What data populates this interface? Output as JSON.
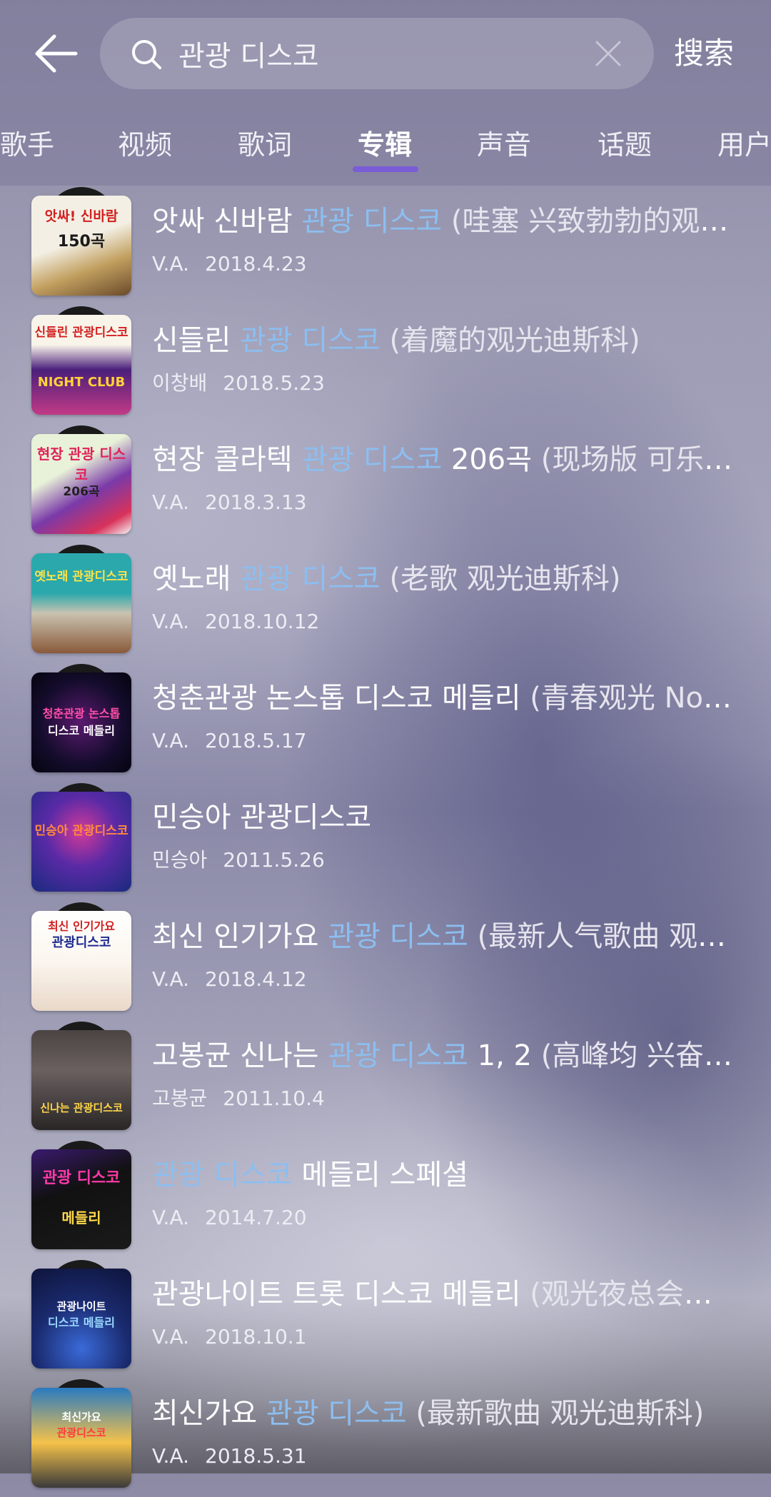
{
  "header": {
    "search_query": "관광 디스코",
    "search_button_label": "搜索"
  },
  "tabs": [
    {
      "label": "歌手",
      "active": false
    },
    {
      "label": "视频",
      "active": false
    },
    {
      "label": "歌词",
      "active": false
    },
    {
      "label": "专辑",
      "active": true
    },
    {
      "label": "声音",
      "active": false
    },
    {
      "label": "话题",
      "active": false
    },
    {
      "label": "用户",
      "active": false
    }
  ],
  "albums": [
    {
      "title_pre": "앗싸 신바람 ",
      "title_hl": "관광 디스코",
      "title_post": "",
      "title_tr": " (哇塞 兴致勃勃的观光迪斯科)",
      "artist": "V.A.",
      "date": "2018.4.23"
    },
    {
      "title_pre": "신들린 ",
      "title_hl": "관광 디스코",
      "title_post": "",
      "title_tr": " (着魔的观光迪斯科)",
      "artist": "이창배",
      "date": "2018.5.23"
    },
    {
      "title_pre": "현장 콜라텍 ",
      "title_hl": "관광 디스코",
      "title_post": " 206곡",
      "title_tr": " (现场版 可乐迪斯科)",
      "artist": "V.A.",
      "date": "2018.3.13"
    },
    {
      "title_pre": "옛노래 ",
      "title_hl": "관광 디스코",
      "title_post": "",
      "title_tr": " (老歌 观光迪斯科)",
      "artist": "V.A.",
      "date": "2018.10.12"
    },
    {
      "title_pre": "청춘관광 논스톱 디스코 메들리",
      "title_hl": "",
      "title_post": "",
      "title_tr": " (青春观光 Nonstop)",
      "artist": "V.A.",
      "date": "2018.5.17"
    },
    {
      "title_pre": "민승아 관광디스코",
      "title_hl": "",
      "title_post": "",
      "title_tr": "",
      "artist": "민승아",
      "date": "2011.5.26"
    },
    {
      "title_pre": "최신 인기가요 ",
      "title_hl": "관광 디스코",
      "title_post": "",
      "title_tr": " (最新人气歌曲 观光迪斯科)",
      "artist": "V.A.",
      "date": "2018.4.12"
    },
    {
      "title_pre": "고봉균 신나는 ",
      "title_hl": "관광 디스코",
      "title_post": " 1, 2",
      "title_tr": " (高峰均 兴奋的观光迪斯科)",
      "artist": "고봉균",
      "date": "2011.10.4"
    },
    {
      "title_pre": "",
      "title_hl": "관광 디스코",
      "title_post": " 메들리 스페셜",
      "title_tr": "",
      "artist": "V.A.",
      "date": "2014.7.20"
    },
    {
      "title_pre": "관광나이트 트롯 디스코 메들리",
      "title_hl": "",
      "title_post": "",
      "title_tr": " (观光夜总会迪斯科)",
      "artist": "V.A.",
      "date": "2018.10.1"
    },
    {
      "title_pre": "최신가요 ",
      "title_hl": "관광 디스코",
      "title_post": "",
      "title_tr": " (最新歌曲 观光迪斯科)",
      "artist": "V.A.",
      "date": "2018.5.31"
    }
  ],
  "covers": [
    {
      "text": "앗싸! 신바람",
      "sub": "150곡",
      "bg": "#f2efe6",
      "fg": "#d21f1f"
    },
    {
      "text": "신들린 관광디스코",
      "sub": "NIGHT CLUB",
      "bg": "#3a1a5e",
      "fg": "#ffd23a"
    },
    {
      "text": "현장 관광 디스코",
      "sub": "206곡",
      "bg": "#e7f0d8",
      "fg": "#e0225a"
    },
    {
      "text": "옛노래 관광디스코",
      "sub": "",
      "bg": "#27a3a8",
      "fg": "#fbe34a"
    },
    {
      "text": "청춘관광 논스톱",
      "sub": "디스코 메들리",
      "bg": "#0d0a2a",
      "fg": "#ff4fa8"
    },
    {
      "text": "민승아 관광디스코",
      "sub": "",
      "bg": "#2b2a86",
      "fg": "#ff5a3c"
    },
    {
      "text": "최신 인기가요",
      "sub": "관광디스코",
      "bg": "#fbfbfb",
      "fg": "#1c2a8f"
    },
    {
      "text": "신나는 관광디스코",
      "sub": "",
      "bg": "#3b3636",
      "fg": "#ffd84a"
    },
    {
      "text": "관광 디스코",
      "sub": "메들리",
      "bg": "#111",
      "fg": "#ff3aa8"
    },
    {
      "text": "관광나이트",
      "sub": "디스코 메들리",
      "bg": "#1c2a6e",
      "fg": "#9ad8ff"
    },
    {
      "text": "최신가요",
      "sub": "관광디스코",
      "bg": "#2a7ac0",
      "fg": "#ff3a3a"
    }
  ]
}
